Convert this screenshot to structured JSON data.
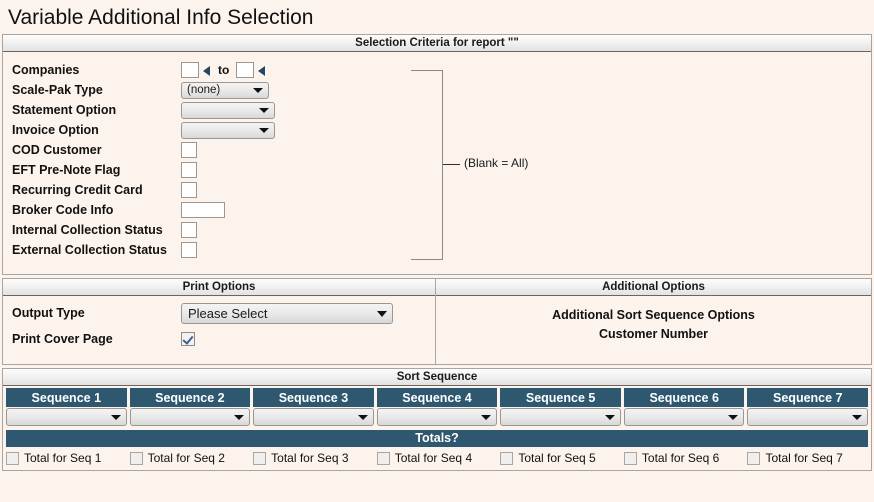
{
  "page": {
    "title": "Variable Additional Info Selection"
  },
  "criteria": {
    "header": "Selection Criteria for report \"\"",
    "to_label": "to",
    "blank_note": "(Blank = All)",
    "rows": [
      {
        "label": "Companies",
        "type": "range",
        "from_value": "",
        "to_value": ""
      },
      {
        "label": "Scale-Pak Type",
        "type": "select",
        "value": "(none)"
      },
      {
        "label": "Statement Option",
        "type": "select",
        "value": ""
      },
      {
        "label": "Invoice Option",
        "type": "select",
        "value": ""
      },
      {
        "label": "COD Customer",
        "type": "text",
        "value": ""
      },
      {
        "label": "EFT Pre-Note Flag",
        "type": "text",
        "value": ""
      },
      {
        "label": "Recurring Credit Card",
        "type": "text",
        "value": ""
      },
      {
        "label": "Broker Code Info",
        "type": "text_wide",
        "value": ""
      },
      {
        "label": "Internal Collection Status",
        "type": "text",
        "value": ""
      },
      {
        "label": "External Collection Status",
        "type": "text",
        "value": ""
      }
    ]
  },
  "print_options": {
    "header": "Print Options",
    "output_type_label": "Output Type",
    "output_type_value": "Please Select",
    "cover_page_label": "Print Cover Page",
    "cover_page_checked": true
  },
  "additional_options": {
    "header": "Additional Options",
    "line1": "Additional Sort Sequence Options",
    "line2": "Customer Number"
  },
  "sort_sequence": {
    "header": "Sort Sequence",
    "totals_header": "Totals?",
    "columns": [
      {
        "head": "Sequence 1",
        "value": "",
        "total_label": "Total for Seq 1",
        "total_checked": false
      },
      {
        "head": "Sequence 2",
        "value": "",
        "total_label": "Total for Seq 2",
        "total_checked": false
      },
      {
        "head": "Sequence 3",
        "value": "",
        "total_label": "Total for Seq 3",
        "total_checked": false
      },
      {
        "head": "Sequence 4",
        "value": "",
        "total_label": "Total for Seq 4",
        "total_checked": false
      },
      {
        "head": "Sequence 5",
        "value": "",
        "total_label": "Total for Seq 5",
        "total_checked": false
      },
      {
        "head": "Sequence 6",
        "value": "",
        "total_label": "Total for Seq 6",
        "total_checked": false
      },
      {
        "head": "Sequence 7",
        "value": "",
        "total_label": "Total for Seq 7",
        "total_checked": false
      }
    ]
  },
  "colors": {
    "page_background": "#fcf3ec",
    "panel_border": "#a8a49f",
    "header_bar_text": "#1a1a1a",
    "sequence_header_bg": "#2e5770",
    "sequence_header_text": "#ffffff",
    "lookup_arrow": "#27455e",
    "checkmark": "#3a5f8f"
  }
}
